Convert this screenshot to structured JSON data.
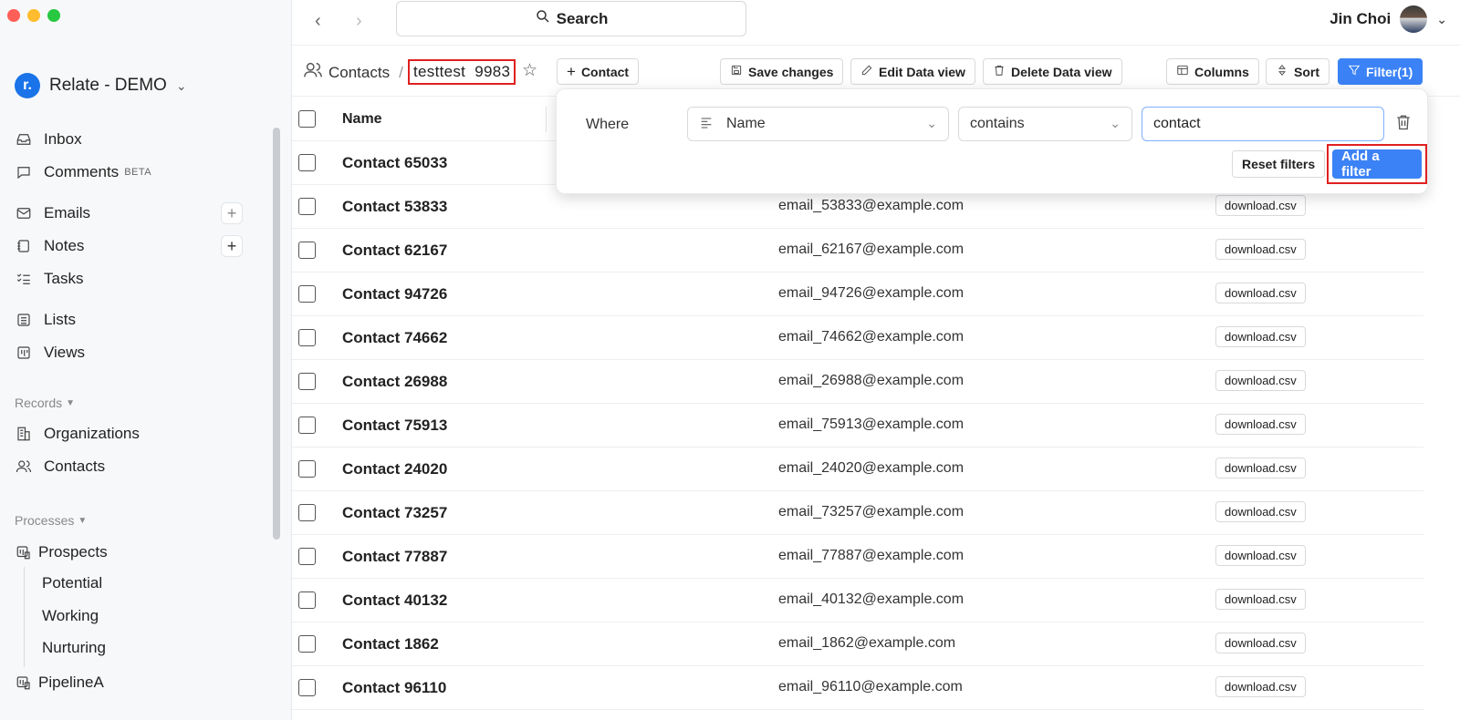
{
  "workspace": {
    "initial": "r.",
    "name": "Relate - DEMO"
  },
  "nav": {
    "inbox": "Inbox",
    "comments": "Comments",
    "comments_badge": "BETA",
    "emails": "Emails",
    "notes": "Notes",
    "tasks": "Tasks",
    "lists": "Lists",
    "views": "Views"
  },
  "records": {
    "label": "Records",
    "organizations": "Organizations",
    "contacts": "Contacts"
  },
  "processes": {
    "label": "Processes",
    "prospects": "Prospects",
    "stages": [
      "Potential",
      "Working",
      "Nurturing"
    ],
    "pipeline": "PipelineA"
  },
  "topbar": {
    "search": "Search",
    "user": "Jin Choi"
  },
  "toolbar": {
    "breadcrumb": "Contacts",
    "separator": "/",
    "view_name": "testtest  9983",
    "add_contact": "Contact",
    "save_changes": "Save changes",
    "edit_view": "Edit Data view",
    "delete_view": "Delete Data view",
    "columns": "Columns",
    "sort": "Sort",
    "filter": "Filter(1)"
  },
  "table": {
    "header_name": "Name",
    "rows": [
      {
        "name": "Contact 65033",
        "email": "",
        "file": ""
      },
      {
        "name": "Contact 53833",
        "email": "email_53833@example.com",
        "file": "download.csv"
      },
      {
        "name": "Contact 62167",
        "email": "email_62167@example.com",
        "file": "download.csv"
      },
      {
        "name": "Contact 94726",
        "email": "email_94726@example.com",
        "file": "download.csv"
      },
      {
        "name": "Contact 74662",
        "email": "email_74662@example.com",
        "file": "download.csv"
      },
      {
        "name": "Contact 26988",
        "email": "email_26988@example.com",
        "file": "download.csv"
      },
      {
        "name": "Contact 75913",
        "email": "email_75913@example.com",
        "file": "download.csv"
      },
      {
        "name": "Contact 24020",
        "email": "email_24020@example.com",
        "file": "download.csv"
      },
      {
        "name": "Contact 73257",
        "email": "email_73257@example.com",
        "file": "download.csv"
      },
      {
        "name": "Contact 77887",
        "email": "email_77887@example.com",
        "file": "download.csv"
      },
      {
        "name": "Contact 40132",
        "email": "email_40132@example.com",
        "file": "download.csv"
      },
      {
        "name": "Contact 1862",
        "email": "email_1862@example.com",
        "file": "download.csv"
      },
      {
        "name": "Contact 96110",
        "email": "email_96110@example.com",
        "file": "download.csv"
      }
    ]
  },
  "filter": {
    "where": "Where",
    "field": "Name",
    "operator": "contains",
    "value": "contact",
    "reset": "Reset filters",
    "add": "Add a filter"
  },
  "colors": {
    "accent": "#3b82f6",
    "highlight": "#e02020",
    "brand": "#1a73e8"
  }
}
